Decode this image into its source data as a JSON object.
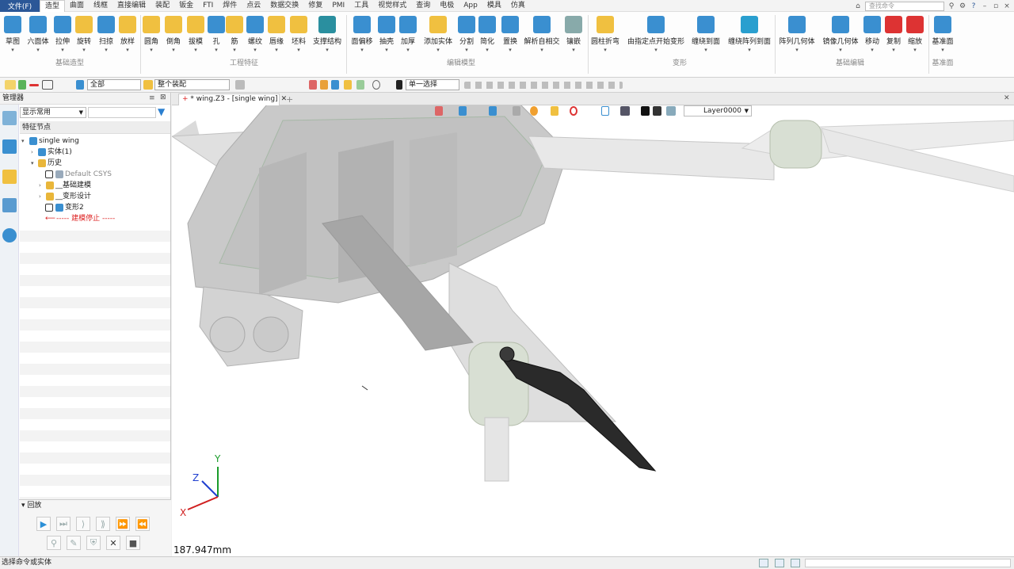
{
  "menu": {
    "file": "文件(F)",
    "tabs": [
      "造型",
      "曲面",
      "线框",
      "直接编辑",
      "装配",
      "钣金",
      "FTI",
      "焊件",
      "点云",
      "数据交换",
      "修复",
      "PMI",
      "工具",
      "视觉样式",
      "查询",
      "电极",
      "App",
      "模具",
      "仿真"
    ],
    "search_placeholder": "查找命令"
  },
  "ribbon": {
    "buttons": [
      "草图",
      "六面体",
      "拉伸",
      "旋转",
      "扫掠",
      "放样",
      "圆角",
      "倒角",
      "拔模",
      "孔",
      "筋",
      "螺纹",
      "唇缘",
      "坯料",
      "支撑结构",
      "面偏移",
      "抽壳",
      "加厚",
      "添加实体",
      "分割",
      "简化",
      "置换",
      "解析自相交",
      "镶嵌",
      "圆柱折弯",
      "由指定点开始变形",
      "缠绕到面",
      "缠绕阵列到面",
      "阵列几何体",
      "镜像几何体",
      "移动",
      "复制",
      "缩放",
      "基准面"
    ],
    "groups": [
      "基础造型",
      "工程特征",
      "编辑模型",
      "变形",
      "基础编辑",
      "基准面"
    ]
  },
  "toolbar2": {
    "filter": "全部",
    "assembly": "整个装配",
    "select_mode": "单一选择"
  },
  "manager": {
    "title": "管理器",
    "display": "显示常用",
    "tree_header": "特征节点",
    "tree": {
      "root": "single wing",
      "solids": "实体(1)",
      "history": "历史",
      "csys": "Default CSYS",
      "basic": "__基础建模",
      "deform": "__变形设计",
      "deform2": "变形2",
      "stop": "----- 建模停止 -----"
    },
    "playback_title": "回放"
  },
  "viewport": {
    "tab": "* wing.Z3 - [single wing]",
    "layer": "Layer0000",
    "measurement": "187.947mm",
    "axes": {
      "x": "X",
      "y": "Y",
      "z": "Z"
    }
  },
  "status": {
    "message": "选择命令或实体"
  },
  "colors": {
    "accent": "#2b5797",
    "ribbon_icon_yellow": "#f0c040",
    "ribbon_icon_blue": "#3a8fd0",
    "propeller": "#2a2a2a",
    "body_gray": "#8a8a8a"
  }
}
